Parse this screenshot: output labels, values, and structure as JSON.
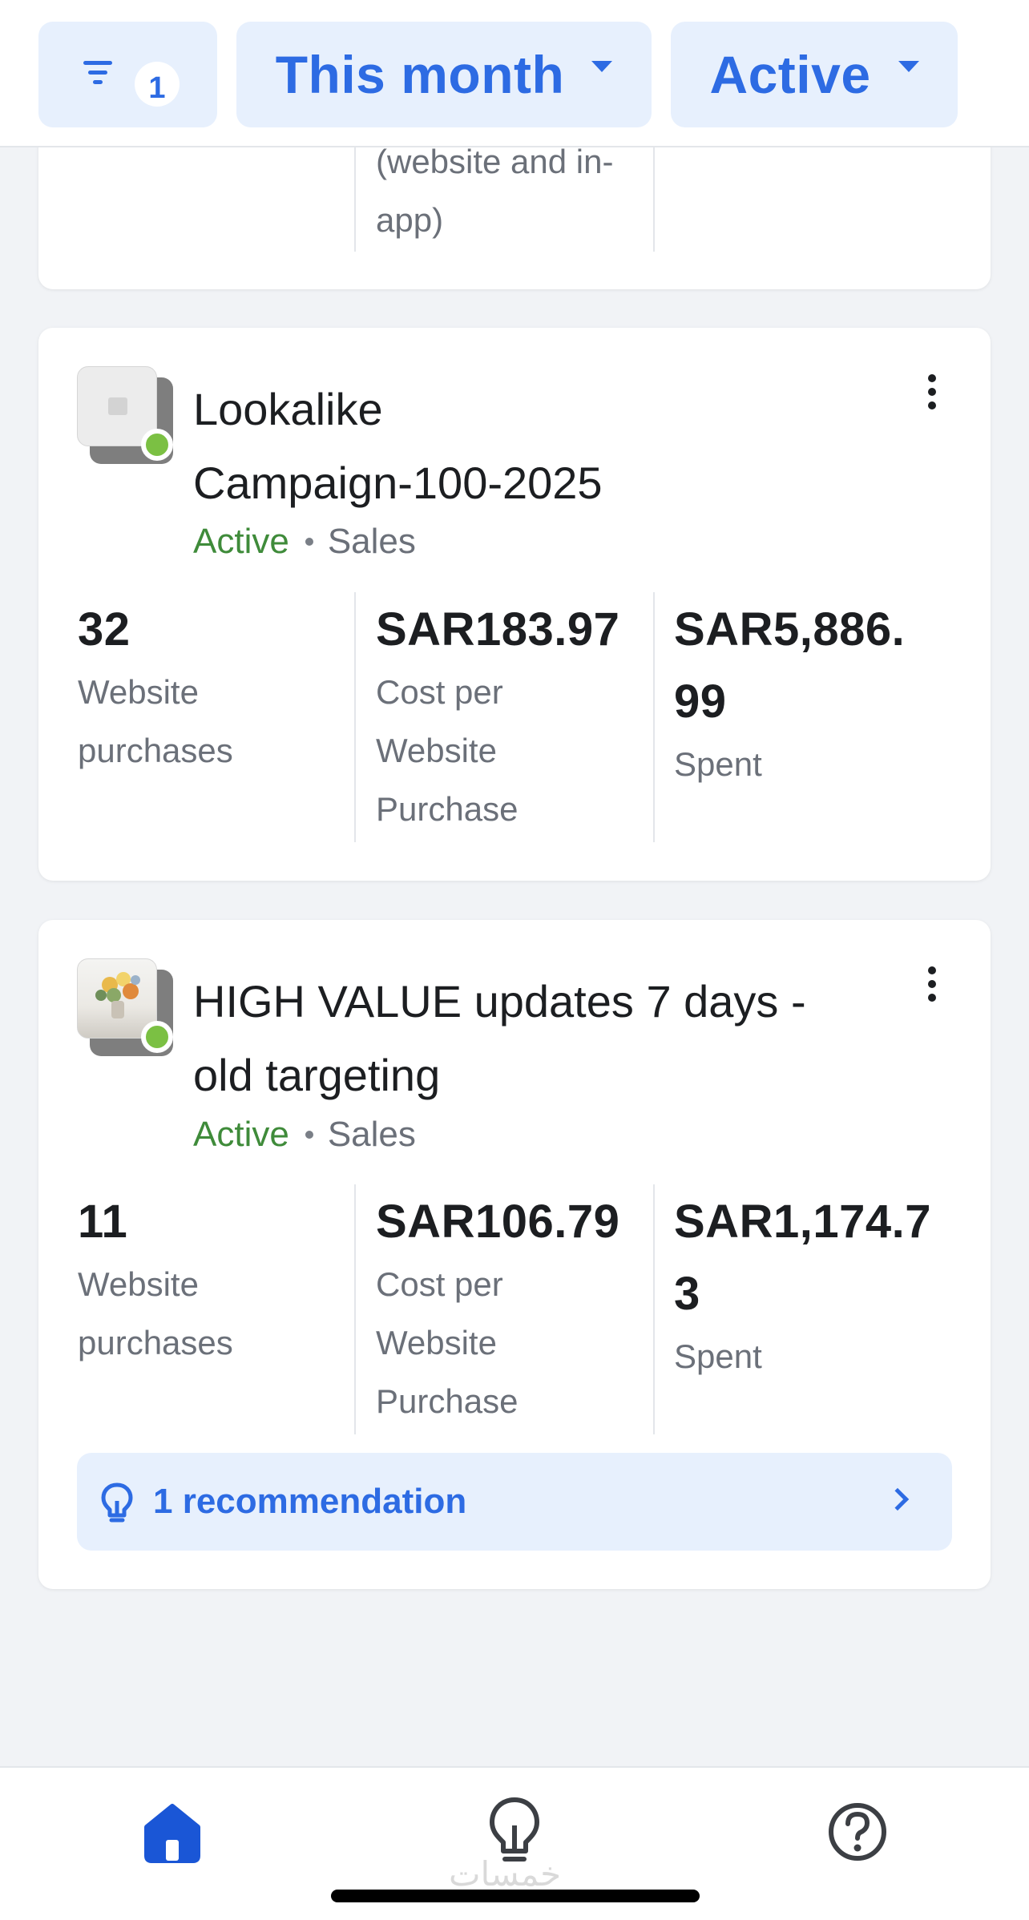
{
  "filters": {
    "filter_count": "1",
    "date_range": "This month",
    "status": "Active"
  },
  "previous_card": {
    "cost_label_tail": [
      "(website and in-",
      "app)"
    ]
  },
  "campaigns": [
    {
      "title_lines": [
        "Lookalike",
        "Campaign-100-2025"
      ],
      "status": "Active",
      "category": "Sales",
      "status_color": "#7bc043",
      "metrics": [
        {
          "value_lines": [
            "32"
          ],
          "label_lines": [
            "Website",
            "purchases"
          ]
        },
        {
          "value_lines": [
            "SAR183.97"
          ],
          "label_lines": [
            "Cost per",
            "Website",
            "Purchase"
          ]
        },
        {
          "value_lines": [
            "SAR5,886.",
            "99"
          ],
          "label_lines": [
            "Spent"
          ]
        }
      ]
    },
    {
      "title_lines": [
        "HIGH VALUE updates 7 days -",
        "old targeting"
      ],
      "status": "Active",
      "category": "Sales",
      "status_color": "#7bc043",
      "metrics": [
        {
          "value_lines": [
            "11"
          ],
          "label_lines": [
            "Website",
            "purchases"
          ]
        },
        {
          "value_lines": [
            "SAR106.79"
          ],
          "label_lines": [
            "Cost per",
            "Website",
            "Purchase"
          ]
        },
        {
          "value_lines": [
            "SAR1,174.7",
            "3"
          ],
          "label_lines": [
            "Spent"
          ]
        }
      ],
      "recommendation": "1 recommendation"
    }
  ],
  "tabbar": {
    "tabs": [
      {
        "icon": "home-icon",
        "active": true
      },
      {
        "icon": "lightbulb-icon",
        "active": false
      },
      {
        "icon": "help-icon",
        "active": false
      }
    ],
    "watermark": "خمسات"
  },
  "colors": {
    "accent": "#2d6be3",
    "pill_bg": "#e7f0fd",
    "active_text": "#3f8b3a",
    "status_dot": "#7bc043",
    "home_active": "#1a56d6"
  }
}
